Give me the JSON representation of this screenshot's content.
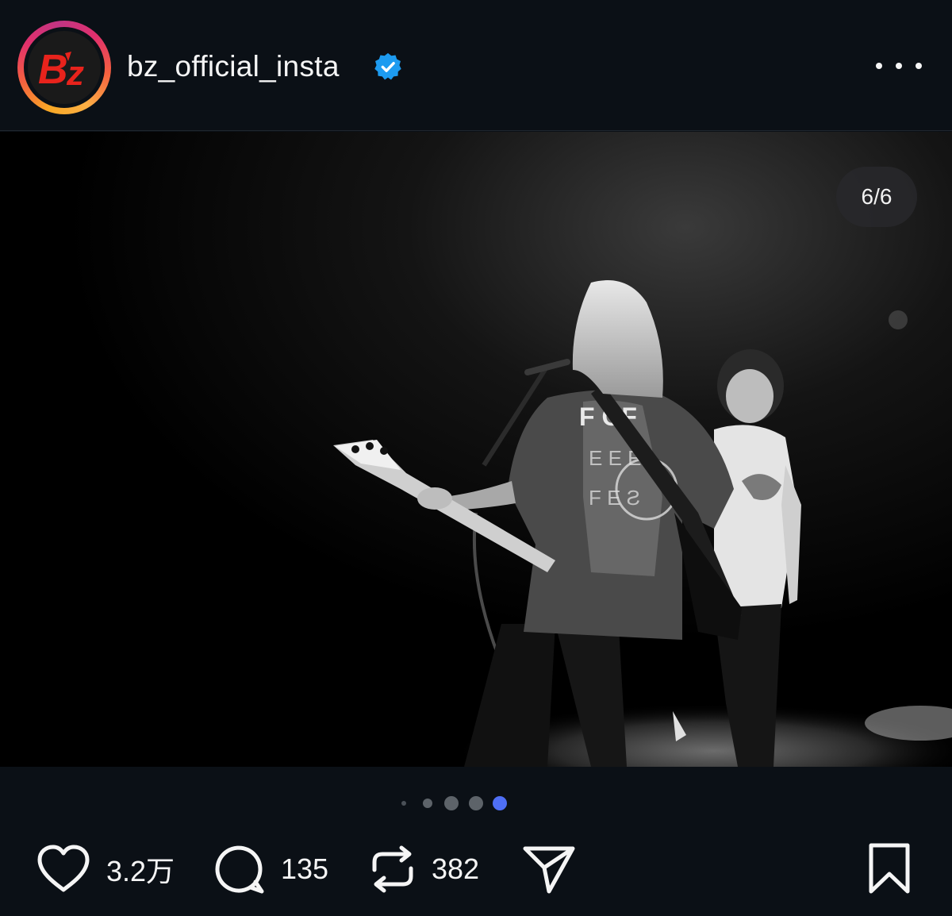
{
  "header": {
    "avatar_icon": "bz-logo",
    "avatar_logo_text": "B'z",
    "username": "bz_official_insta",
    "verified_icon": "verified-badge-icon",
    "more_icon": "more-options-icon"
  },
  "media": {
    "description_icon": "concert-photo",
    "counter": "6/6",
    "carousel": {
      "total": 5,
      "active_index": 4
    }
  },
  "actions": {
    "like": {
      "icon": "heart-icon",
      "count": "3.2万"
    },
    "comment": {
      "icon": "comment-icon",
      "count": "135"
    },
    "repost": {
      "icon": "repost-icon",
      "count": "382"
    },
    "share": {
      "icon": "send-icon"
    },
    "save": {
      "icon": "bookmark-icon"
    }
  },
  "colors": {
    "background": "#0b1016",
    "active_dot": "#4f6ff5",
    "verified": "#1d9bf0"
  }
}
